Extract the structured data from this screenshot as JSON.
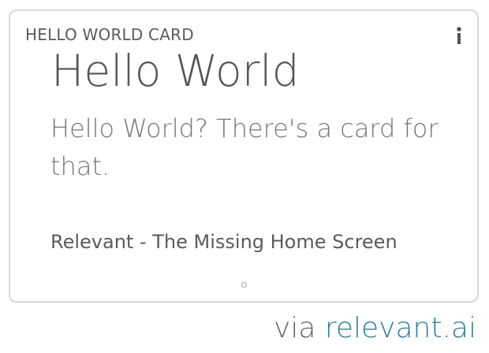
{
  "card": {
    "header": "HELLO WORLD CARD",
    "title": "Hello World",
    "body": "Hello World? There's a card for that.",
    "source": "Relevant - The Missing Home Screen",
    "info_icon": "info-icon",
    "pager_icon": "page-indicator-dot"
  },
  "attribution": {
    "prefix": "via",
    "link": "relevant.ai"
  },
  "colors": {
    "card_border": "#d9d9d9",
    "text_dark": "#555555",
    "text_mid": "#777777",
    "link": "#2e7f94"
  }
}
